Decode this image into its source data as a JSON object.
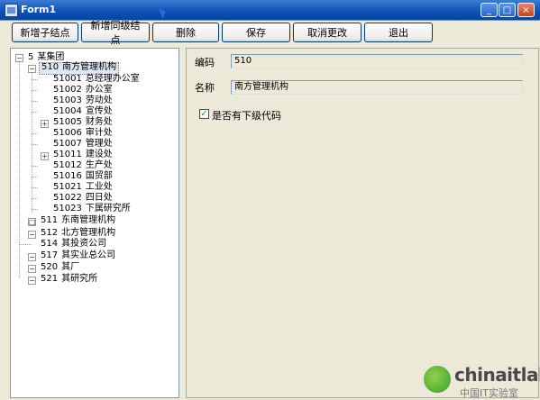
{
  "window": {
    "title": "Form1",
    "min_glyph": "_",
    "max_glyph": "□",
    "close_glyph": "×"
  },
  "toolbar": {
    "add_child": "新增子结点",
    "add_sibling": "新增同级结点",
    "delete": "删除",
    "save": "保存",
    "cancel": "取消更改",
    "exit": "退出"
  },
  "tree": {
    "nodes": [
      {
        "code": "5",
        "name": "某集团",
        "expander": "−"
      },
      {
        "code": "510",
        "name": "南方管理机构",
        "expander": "−"
      },
      {
        "code": "51001",
        "name": "总经理办公室"
      },
      {
        "code": "51002",
        "name": "办公室"
      },
      {
        "code": "51003",
        "name": "劳动处"
      },
      {
        "code": "51004",
        "name": "宣传处"
      },
      {
        "code": "51005",
        "name": "财务处",
        "expander": "+"
      },
      {
        "code": "51006",
        "name": "审计处"
      },
      {
        "code": "51007",
        "name": "管理处"
      },
      {
        "code": "51011",
        "name": "建设处",
        "expander": "+"
      },
      {
        "code": "51012",
        "name": "生产处"
      },
      {
        "code": "51016",
        "name": "国贸部"
      },
      {
        "code": "51021",
        "name": "工业处"
      },
      {
        "code": "51022",
        "name": "四日处"
      },
      {
        "code": "51023",
        "name": "下属研究所"
      },
      {
        "code": "511",
        "name": "东南管理机构",
        "expander": "□"
      },
      {
        "code": "512",
        "name": "北方管理机构",
        "expander": "−"
      },
      {
        "code": "514",
        "name": "其投资公司"
      },
      {
        "code": "517",
        "name": "其实业总公司",
        "expander": "−"
      },
      {
        "code": "520",
        "name": "其厂",
        "expander": "−"
      },
      {
        "code": "521",
        "name": "其研究所",
        "expander": "−"
      }
    ]
  },
  "detail": {
    "code_label": "编码",
    "code_value": "510",
    "name_label": "名称",
    "name_value": "南方管理机构",
    "has_sub_label": "是否有下级代码",
    "has_sub_checked": "✓"
  },
  "brand": {
    "name": "chinaitlab",
    "sub": "中国IT实验室"
  }
}
